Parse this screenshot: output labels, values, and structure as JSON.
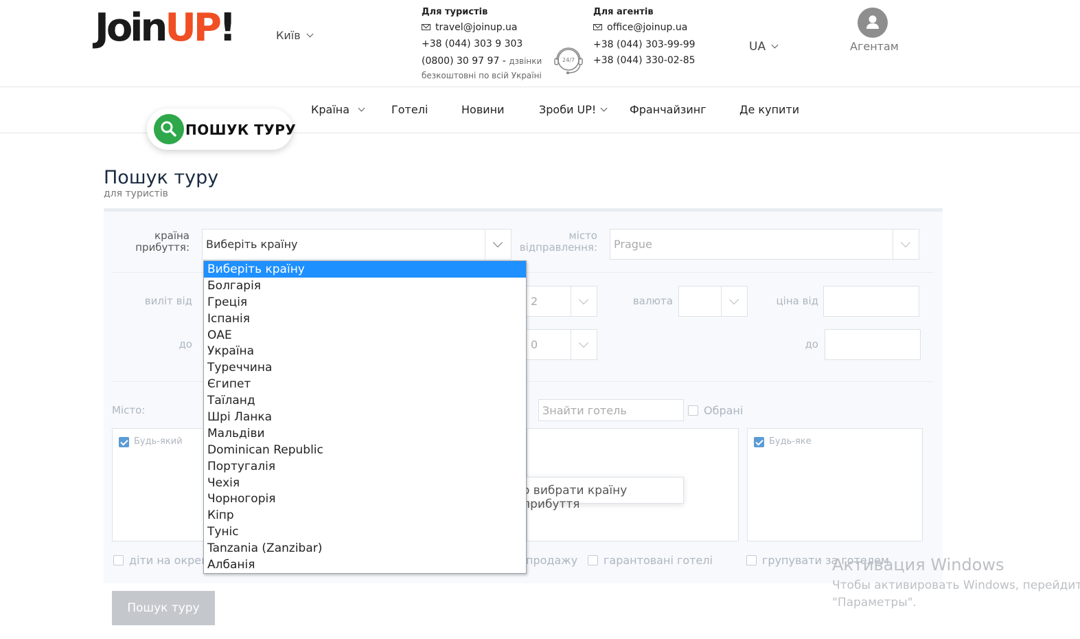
{
  "header": {
    "logo_dark": "Join",
    "logo_accent": "UP",
    "logo_mark": "!",
    "city": "Київ",
    "tourists": {
      "title": "Для туристів",
      "email": "travel@joinup.ua",
      "phone1": "+38 (044) 303 9 303",
      "phone2": "(0800) 30 97 97 -",
      "phone2_note": "дзвінки",
      "free_note": "безкоштовні по всій Україні"
    },
    "support_icon_text": "24/7",
    "agents": {
      "title": "Для агентів",
      "email": "office@joinup.ua",
      "phone1": "+38 (044) 303-99-99",
      "phone2": "+38 (044) 330-02-85"
    },
    "language": "UA",
    "agents_link": "Агентам"
  },
  "nav": {
    "search_badge": "ПОШУК ТУРУ",
    "items": [
      "Країна",
      "Готелі",
      "Новини",
      "Зроби UP!",
      "Франчайзинг",
      "Де купити"
    ]
  },
  "page": {
    "title": "Пошук туру",
    "subtitle": "для туристів"
  },
  "form": {
    "arrival_country_label_1": "країна",
    "arrival_country_label_2": "прибуття:",
    "arrival_country_value": "Виберіть країну",
    "departure_city_label_1": "місто",
    "departure_city_label_2": "відправлення:",
    "departure_city_value": "Prague",
    "departure_from_label": "виліт від",
    "departure_to_label": "до",
    "nights_from_value": "2",
    "nights_to_value": "0",
    "currency_label": "валюта",
    "price_from_label": "ціна від",
    "price_to_label": "до",
    "city_label": "Місто:",
    "hotel_search_placeholder": "Знайти готель",
    "favorites_label": "Обрані",
    "any_city_label": "Будь-який",
    "any_meal_label": "Будь-яке",
    "choose_country_hint": "о вибрати країну прибуття",
    "children_label": "діти на окремо",
    "on_sale_label": "продажу",
    "guaranteed_label": "гарантовані готелі",
    "group_by_hotel_label": "групувати за готелем",
    "search_button": "Пошук туру"
  },
  "dropdown": {
    "options": [
      "Виберіть країну",
      "Болгарія",
      "Греція",
      "Іспанія",
      "ОАЕ",
      "Україна",
      "Туреччина",
      "Єгипет",
      "Таїланд",
      "Шрі Ланка",
      "Мальдіви",
      "Dominican Republic",
      "Португалія",
      "Чехія",
      "Чорногорія",
      "Кіпр",
      "Туніс",
      "Tanzania (Zanzibar)",
      "Албанія"
    ],
    "selected_index": 0
  },
  "watermark": {
    "title": "Активация Windows",
    "line1": "Чтобы активировать Windows, перейдите в",
    "line2": "\"Параметры\"."
  }
}
